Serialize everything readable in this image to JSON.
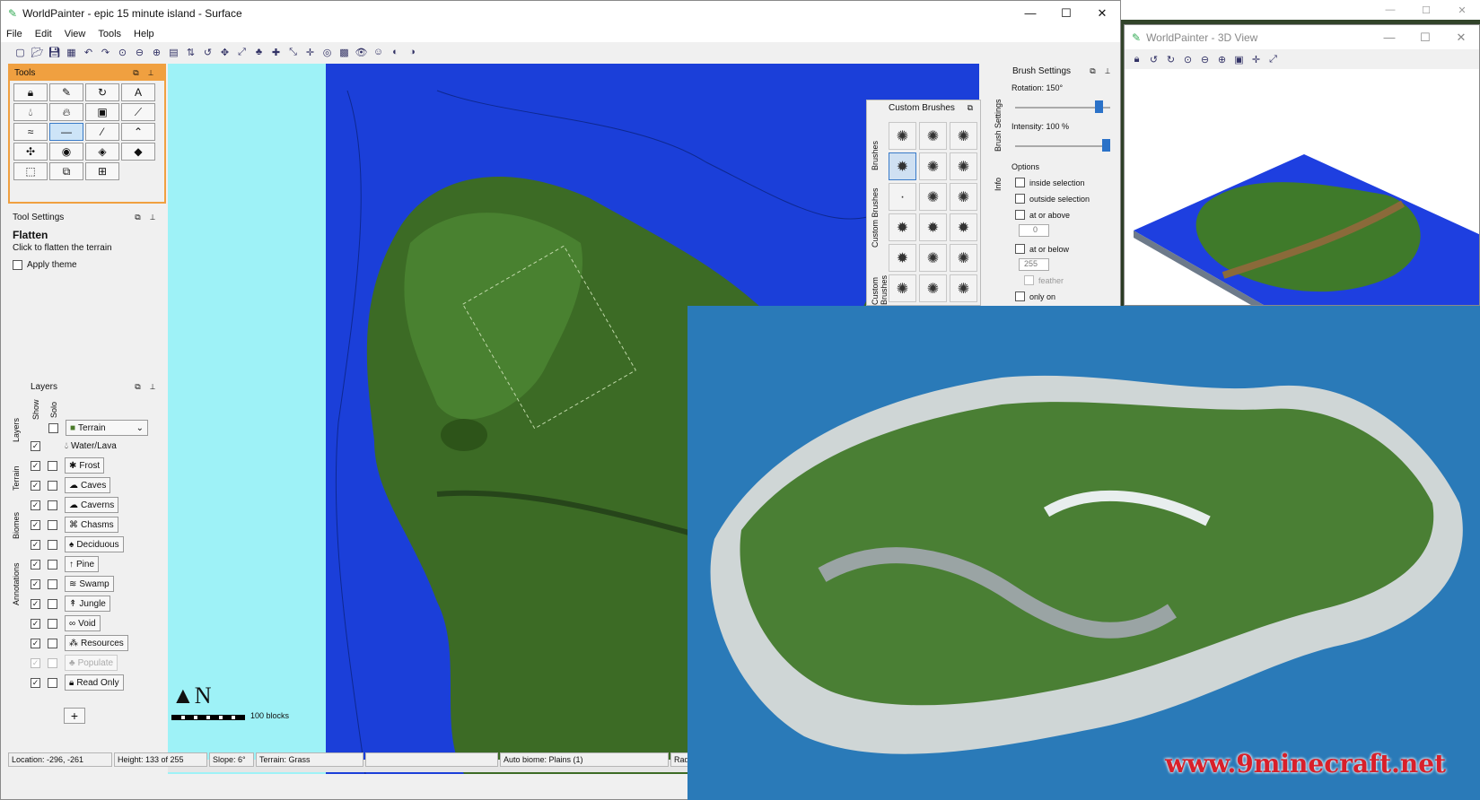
{
  "main_window": {
    "title": "WorldPainter - epic 15 minute island - Surface",
    "controls": {
      "minimize": "—",
      "maximize": "☐",
      "close": "✕"
    },
    "menu": [
      "File",
      "Edit",
      "View",
      "Tools",
      "Help"
    ]
  },
  "tools_panel": {
    "title": "Tools",
    "buttons": [
      {
        "name": "tool-pencil-lock",
        "glyph": "🔒︎"
      },
      {
        "name": "tool-pencil",
        "glyph": "✎"
      },
      {
        "name": "tool-rotate",
        "glyph": "↻"
      },
      {
        "name": "tool-text",
        "glyph": "A"
      },
      {
        "name": "tool-water",
        "glyph": "💧︎"
      },
      {
        "name": "tool-lava",
        "glyph": "🔥︎"
      },
      {
        "name": "tool-image",
        "glyph": "▣"
      },
      {
        "name": "tool-eyedropper",
        "glyph": "⟋"
      },
      {
        "name": "tool-smooth",
        "glyph": "≈"
      },
      {
        "name": "tool-flatten",
        "glyph": "—"
      },
      {
        "name": "tool-slope",
        "glyph": "⁄"
      },
      {
        "name": "tool-raise",
        "glyph": "⌃"
      },
      {
        "name": "tool-spray",
        "glyph": "✣"
      },
      {
        "name": "tool-sponge",
        "glyph": "◉"
      },
      {
        "name": "tool-diamond",
        "glyph": "◈"
      },
      {
        "name": "tool-diamond-2",
        "glyph": "◆"
      },
      {
        "name": "tool-select",
        "glyph": "⬚"
      },
      {
        "name": "tool-copy",
        "glyph": "⧉"
      },
      {
        "name": "tool-fill",
        "glyph": "⊞"
      }
    ]
  },
  "tool_settings": {
    "title": "Tool Settings",
    "tool_name": "Flatten",
    "description": "Click to flatten the terrain",
    "apply_theme": "Apply theme"
  },
  "layers_panel": {
    "title": "Layers",
    "col_show": "Show",
    "col_solo": "Solo",
    "tabs": [
      "Layers",
      "Terrain",
      "Biomes",
      "Annotations"
    ],
    "terrain_select": "Terrain",
    "add": "+",
    "rows": [
      {
        "label": "Water/Lava",
        "show": true,
        "solo": false,
        "has_solo": false,
        "dim": false
      },
      {
        "label": "Frost",
        "show": true,
        "solo": false,
        "has_solo": true,
        "dim": false
      },
      {
        "label": "Caves",
        "show": true,
        "solo": false,
        "has_solo": true,
        "dim": false
      },
      {
        "label": "Caverns",
        "show": true,
        "solo": false,
        "has_solo": true,
        "dim": false
      },
      {
        "label": "Chasms",
        "show": true,
        "solo": false,
        "has_solo": true,
        "dim": false
      },
      {
        "label": "Deciduous",
        "show": true,
        "solo": false,
        "has_solo": true,
        "dim": false
      },
      {
        "label": "Pine",
        "show": true,
        "solo": false,
        "has_solo": true,
        "dim": false
      },
      {
        "label": "Swamp",
        "show": true,
        "solo": false,
        "has_solo": true,
        "dim": false
      },
      {
        "label": "Jungle",
        "show": true,
        "solo": false,
        "has_solo": true,
        "dim": false
      },
      {
        "label": "Void",
        "show": true,
        "solo": false,
        "has_solo": true,
        "dim": false
      },
      {
        "label": "Resources",
        "show": true,
        "solo": false,
        "has_solo": true,
        "dim": false
      },
      {
        "label": "Populate",
        "show": true,
        "solo": false,
        "has_solo": true,
        "dim": true
      },
      {
        "label": "Read Only",
        "show": true,
        "solo": false,
        "has_solo": true,
        "dim": false
      }
    ]
  },
  "map": {
    "north": "N",
    "scale_label": "100 blocks"
  },
  "custom_brushes": {
    "title": "Custom Brushes",
    "side_tabs": [
      "Brushes",
      "Custom Brushes",
      "Custom Brushes"
    ],
    "cells": [
      "✺",
      "✺",
      "✺",
      "✹",
      "✺",
      "✺",
      "·",
      "✺",
      "✺",
      "✹",
      "✹",
      "✹",
      "✹",
      "✺",
      "✺",
      "✺",
      "✺",
      "✺"
    ]
  },
  "brush_settings": {
    "title": "Brush Settings",
    "side_tabs": [
      "Brush Settings",
      "Info"
    ],
    "rotation": "Rotation: 150°",
    "intensity": "Intensity: 100 %",
    "rotation_value": 0.92,
    "intensity_value": 1.0,
    "options_title": "Options",
    "inside_selection": "inside selection",
    "outside_selection": "outside selection",
    "at_or_above": "at or above",
    "at_or_above_value": "0",
    "at_or_below": "at or below",
    "at_or_below_value": "255",
    "feather": "feather",
    "only_on": "only on"
  },
  "view3d": {
    "title": "WorldPainter - 3D View",
    "controls": {
      "minimize": "—",
      "maximize": "☐",
      "close": "✕"
    }
  },
  "status_bar": {
    "location": "Location: -296, -261",
    "height": "Height: 133 of 255",
    "slope": "Slope: 6°",
    "terrain": "Terrain: Grass",
    "blank": "",
    "biome": "Auto biome: Plains (1)",
    "radius": "Rad"
  },
  "background_window": {
    "controls": {
      "minimize": "—",
      "maximize": "☐",
      "close": "✕"
    }
  },
  "watermark": "www.9minecraft.net",
  "colors": {
    "water": "#1b3fd9",
    "land": "#3c6b25",
    "sea_render": "#2a7ab8",
    "accent": "#f0a040",
    "watermark": "#d8202a"
  }
}
